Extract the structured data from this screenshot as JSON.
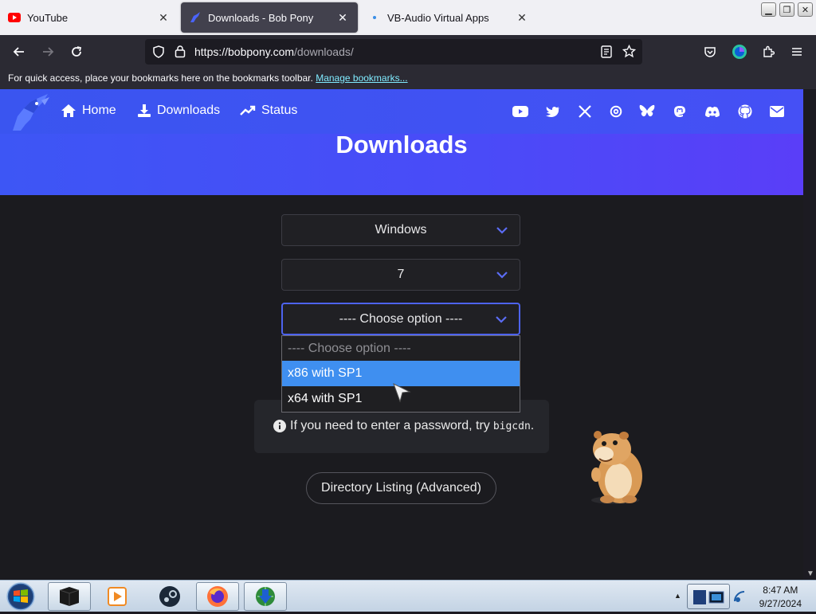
{
  "browser": {
    "tabs": [
      {
        "title": "YouTube",
        "active": false
      },
      {
        "title": "Downloads - Bob Pony",
        "active": true
      },
      {
        "title": "VB-Audio Virtual Apps",
        "active": false
      }
    ],
    "url": {
      "origin": "https://bobpony.com",
      "path": "/downloads/"
    },
    "bookmarks_notice": "For quick access, place your bookmarks here on the bookmarks toolbar.",
    "bookmarks_link": "Manage bookmarks..."
  },
  "site": {
    "nav": [
      {
        "label": "Home",
        "icon": "home-icon"
      },
      {
        "label": "Downloads",
        "icon": "download-icon"
      },
      {
        "label": "Status",
        "icon": "trend-icon"
      }
    ],
    "social_icons": [
      "youtube-icon",
      "twitter-icon",
      "x-icon",
      "threads-icon",
      "bluesky-icon",
      "mastodon-icon",
      "discord-icon",
      "github-icon",
      "email-icon"
    ],
    "title": "Downloads",
    "accent": "#3d56f5"
  },
  "form": {
    "os_select": "Windows",
    "version_select": "7",
    "edition_select": "---- Choose option ----",
    "dropdown_options": [
      "---- Choose option ----",
      "x86 with SP1",
      "x64 with SP1"
    ],
    "highlighted_option": "x86 with SP1"
  },
  "info": {
    "text": "If you need to enter a password, try",
    "code": "bigcdn",
    "suffix": "."
  },
  "directory_button": "Directory Listing (Advanced)",
  "taskbar": {
    "time": "8:47 AM",
    "date": "9/27/2024"
  }
}
